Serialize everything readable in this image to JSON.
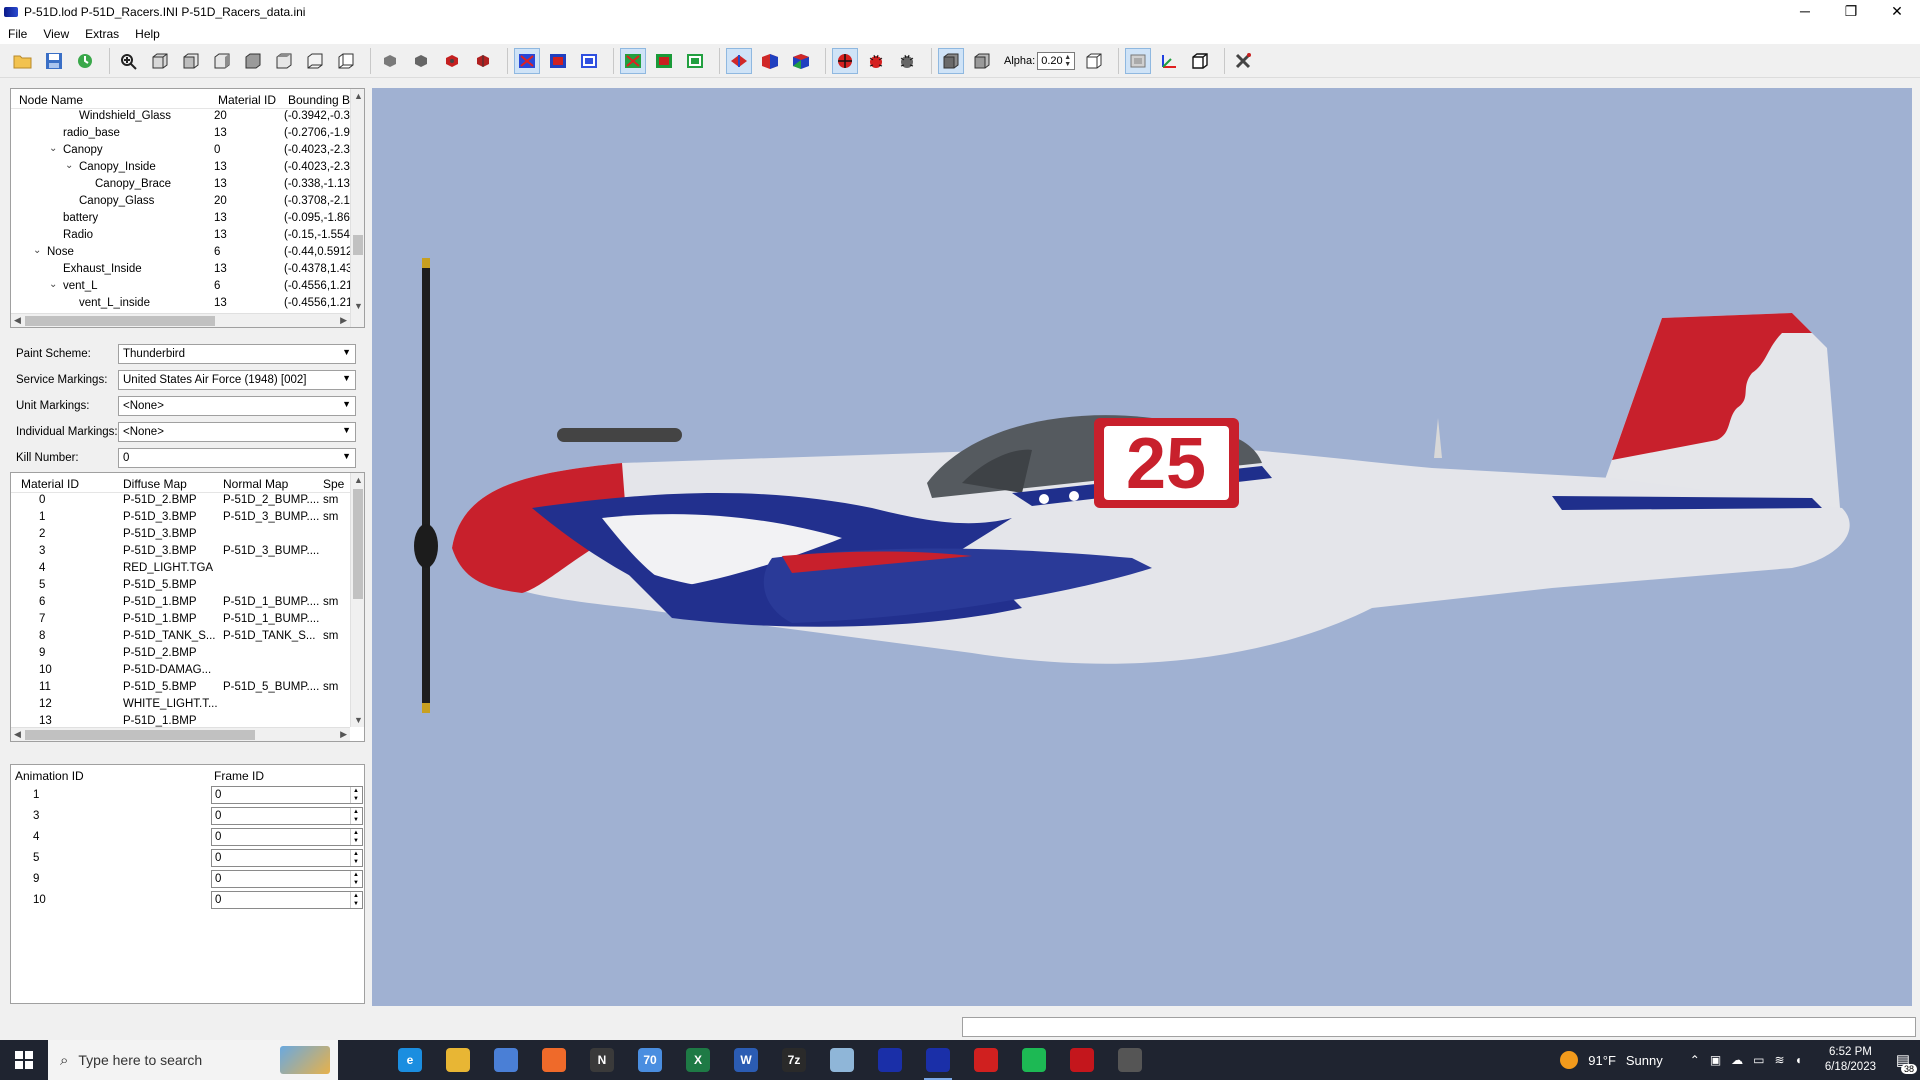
{
  "window": {
    "title": "P-51D.lod  P-51D_Racers.INI  P-51D_Racers_data.ini",
    "controls": {
      "minimize": "─",
      "restore": "❐",
      "close": "✕"
    }
  },
  "menu": [
    "File",
    "View",
    "Extras",
    "Help"
  ],
  "toolbar": {
    "alpha_label": "Alpha:",
    "alpha_value": "0.20",
    "icons": [
      "open-icon",
      "save-icon",
      "refresh-icon",
      "zoom-icon",
      "view-box-icon",
      "view-front-icon",
      "view-side-icon",
      "view-top-icon",
      "view-back-icon",
      "view-bottom-icon",
      "bomb-icon",
      "cube-gray-icon",
      "cube-red-icon",
      "cube-dark-icon",
      "wire-blue-icon",
      "solid-blue-icon",
      "box-blue-icon",
      "wire-green-icon",
      "solid-green-icon",
      "box-green-icon",
      "shade-red-icon",
      "shade-mix-icon",
      "shade-all-icon",
      "target-icon",
      "bug-red-icon",
      "bug-gray-icon",
      "cube-solid-icon",
      "cube-wire-icon",
      "box-outline-icon",
      "mirror-icon",
      "axes-icon",
      "box-3d-icon",
      "tools-icon"
    ]
  },
  "tree": {
    "columns": [
      "Node Name",
      "Material ID",
      "Bounding B"
    ],
    "rows": [
      {
        "name": "Windshield_Glass",
        "indent": 4,
        "expander": "",
        "material": "20",
        "bounds": "(-0.3942,-0.3"
      },
      {
        "name": "radio_base",
        "indent": 3,
        "expander": "",
        "material": "13",
        "bounds": "(-0.2706,-1.9"
      },
      {
        "name": "Canopy",
        "indent": 3,
        "expander": "v",
        "material": "0",
        "bounds": "(-0.4023,-2.3"
      },
      {
        "name": "Canopy_Inside",
        "indent": 4,
        "expander": "v",
        "material": "13",
        "bounds": "(-0.4023,-2.3"
      },
      {
        "name": "Canopy_Brace",
        "indent": 5,
        "expander": "",
        "material": "13",
        "bounds": "(-0.338,-1.13"
      },
      {
        "name": "Canopy_Glass",
        "indent": 4,
        "expander": "",
        "material": "20",
        "bounds": "(-0.3708,-2.1"
      },
      {
        "name": "battery",
        "indent": 3,
        "expander": "",
        "material": "13",
        "bounds": "(-0.095,-1.86"
      },
      {
        "name": "Radio",
        "indent": 3,
        "expander": "",
        "material": "13",
        "bounds": "(-0.15,-1.554"
      },
      {
        "name": "Nose",
        "indent": 2,
        "expander": "v",
        "material": "6",
        "bounds": "(-0.44,0.5912"
      },
      {
        "name": "Exhaust_Inside",
        "indent": 3,
        "expander": "",
        "material": "13",
        "bounds": "(-0.4378,1.43"
      },
      {
        "name": "vent_L",
        "indent": 3,
        "expander": "v",
        "material": "6",
        "bounds": "(-0.4556,1.21"
      },
      {
        "name": "vent_L_inside",
        "indent": 4,
        "expander": "",
        "material": "13",
        "bounds": "(-0.4556,1.21"
      }
    ]
  },
  "properties": [
    {
      "label": "Paint Scheme:",
      "value": "Thunderbird"
    },
    {
      "label": "Service Markings:",
      "value": "United States Air Force (1948) [002]"
    },
    {
      "label": "Unit Markings:",
      "value": "<None>"
    },
    {
      "label": "Individual Markings:",
      "value": "<None>"
    },
    {
      "label": "Kill Number:",
      "value": "0"
    }
  ],
  "materials": {
    "columns": [
      "Material ID",
      "Diffuse Map",
      "Normal Map",
      "Spe"
    ],
    "rows": [
      {
        "id": "0",
        "diffuse": "P-51D_2.BMP",
        "normal": "P-51D_2_BUMP....",
        "spec": "sm"
      },
      {
        "id": "1",
        "diffuse": "P-51D_3.BMP",
        "normal": "P-51D_3_BUMP....",
        "spec": "sm"
      },
      {
        "id": "2",
        "diffuse": "P-51D_3.BMP",
        "normal": "",
        "spec": ""
      },
      {
        "id": "3",
        "diffuse": "P-51D_3.BMP",
        "normal": "P-51D_3_BUMP....",
        "spec": ""
      },
      {
        "id": "4",
        "diffuse": "RED_LIGHT.TGA",
        "normal": "",
        "spec": ""
      },
      {
        "id": "5",
        "diffuse": "P-51D_5.BMP",
        "normal": "",
        "spec": ""
      },
      {
        "id": "6",
        "diffuse": "P-51D_1.BMP",
        "normal": "P-51D_1_BUMP....",
        "spec": "sm"
      },
      {
        "id": "7",
        "diffuse": "P-51D_1.BMP",
        "normal": "P-51D_1_BUMP....",
        "spec": ""
      },
      {
        "id": "8",
        "diffuse": "P-51D_TANK_S...",
        "normal": "P-51D_TANK_S...",
        "spec": "sm"
      },
      {
        "id": "9",
        "diffuse": "P-51D_2.BMP",
        "normal": "",
        "spec": ""
      },
      {
        "id": "10",
        "diffuse": "P-51D-DAMAG...",
        "normal": "",
        "spec": ""
      },
      {
        "id": "11",
        "diffuse": "P-51D_5.BMP",
        "normal": "P-51D_5_BUMP....",
        "spec": "sm"
      },
      {
        "id": "12",
        "diffuse": "WHITE_LIGHT.T...",
        "normal": "",
        "spec": ""
      },
      {
        "id": "13",
        "diffuse": "P-51D_1.BMP",
        "normal": "",
        "spec": ""
      }
    ]
  },
  "animations": {
    "columns": [
      "Animation ID",
      "Frame ID"
    ],
    "rows": [
      {
        "id": "1",
        "frame": "0"
      },
      {
        "id": "3",
        "frame": "0"
      },
      {
        "id": "4",
        "frame": "0"
      },
      {
        "id": "5",
        "frame": "0"
      },
      {
        "id": "9",
        "frame": "0"
      },
      {
        "id": "10",
        "frame": "0"
      }
    ]
  },
  "viewport": {
    "background": "#a0b1d2",
    "race_number": "25"
  },
  "taskbar": {
    "search_placeholder": "Type here to search",
    "apps": [
      {
        "name": "task-view-icon",
        "label": "",
        "color": "#1f2430"
      },
      {
        "name": "edge-icon",
        "label": "e",
        "color": "#1b8ee0"
      },
      {
        "name": "file-explorer-icon",
        "label": "",
        "color": "#e8b634"
      },
      {
        "name": "store-icon",
        "label": "",
        "color": "#4a7fd6"
      },
      {
        "name": "firefox-icon",
        "label": "",
        "color": "#ef6a2a"
      },
      {
        "name": "notion-icon",
        "label": "N",
        "color": "#3a3a3a"
      },
      {
        "name": "mail-icon",
        "label": "70",
        "color": "#4a8ee0"
      },
      {
        "name": "excel-icon",
        "label": "X",
        "color": "#1e7a45"
      },
      {
        "name": "word-icon",
        "label": "W",
        "color": "#2b5cb3"
      },
      {
        "name": "7zip-icon",
        "label": "7z",
        "color": "#2a2a2a"
      },
      {
        "name": "paint-icon",
        "label": "",
        "color": "#8fb6d8"
      },
      {
        "name": "lod-editor-icon",
        "label": "",
        "color": "#1a2fa8"
      },
      {
        "name": "lod-editor-active-icon",
        "label": "",
        "color": "#1a2fa8"
      },
      {
        "name": "acrobat-icon",
        "label": "",
        "color": "#d0201f"
      },
      {
        "name": "spotify-icon",
        "label": "",
        "color": "#1db954"
      },
      {
        "name": "mcafee-icon",
        "label": "",
        "color": "#c4161c"
      },
      {
        "name": "game-icon",
        "label": "",
        "color": "#555"
      }
    ],
    "weather": {
      "temp": "91°F",
      "condition": "Sunny"
    },
    "time": "6:52 PM",
    "date": "6/18/2023",
    "notifications": "38"
  }
}
